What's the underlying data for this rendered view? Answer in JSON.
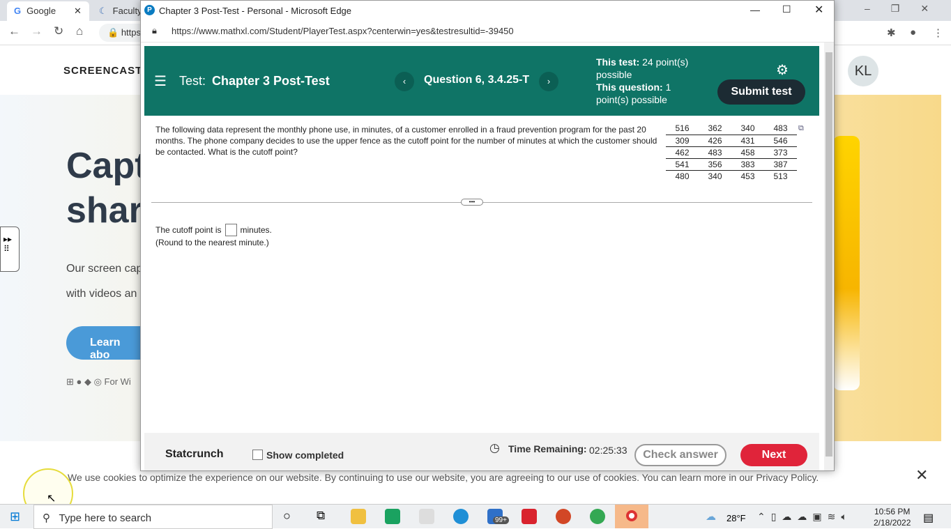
{
  "background_browser": {
    "tabs": [
      {
        "label": "Google"
      },
      {
        "label": "Faculty"
      }
    ],
    "url_partial": "https",
    "site": {
      "brand": "SCREENCAST",
      "hero_title_1": "Capt",
      "hero_title_2": "share",
      "text_1": "Our screen cap",
      "text_2": "with videos an",
      "learn_button": "Learn abo",
      "platforms": "For Wi",
      "cookie_text": "We use cookies to optimize the experience on our website. By continuing to use our website, you are agreeing to our use of cookies. You can learn more in our Privacy Policy.",
      "avatar": "KL"
    }
  },
  "window": {
    "title": "Chapter 3 Post-Test - Personal - Microsoft Edge",
    "url": "https://www.mathxl.com/Student/PlayerTest.aspx?centerwin=yes&testresultid=-39450"
  },
  "header": {
    "test_label": "Test:",
    "test_name": "Chapter 3 Post-Test",
    "question": "Question 6, 3.4.25-T",
    "this_test_label": "This test:",
    "this_test_value": "24 point(s) possible",
    "this_question_label": "This question:",
    "this_question_value": "1 point(s) possible",
    "submit": "Submit test"
  },
  "question": {
    "text": "The following data represent the monthly phone use, in minutes, of a customer enrolled in a fraud prevention program for the past 20 months. The phone company decides to use the upper fence as the cutoff point for the number of minutes at which the customer should be contacted. What is the cutoff point?",
    "data": [
      [
        "516",
        "362",
        "340",
        "483"
      ],
      [
        "309",
        "426",
        "431",
        "546"
      ],
      [
        "462",
        "483",
        "458",
        "373"
      ],
      [
        "541",
        "356",
        "383",
        "387"
      ],
      [
        "480",
        "340",
        "453",
        "513"
      ]
    ],
    "answer_prefix": "The cutoff point is",
    "answer_value": "",
    "answer_suffix": "minutes.",
    "hint": "(Round to the nearest minute.)"
  },
  "footer": {
    "statcrunch": "Statcrunch",
    "show_completed": "Show completed",
    "time_label": "Time Remaining:",
    "time_value": "02:25:33",
    "check_answer": "Check answer",
    "next": "Next"
  },
  "taskbar": {
    "search_placeholder": "Type here to search",
    "weather": "28°F",
    "time": "10:56 PM",
    "date": "2/18/2022",
    "mail_badge": "99+"
  },
  "colors": {
    "header": "#0f7466",
    "next": "#e0243a",
    "submit": "#1c2b33"
  }
}
